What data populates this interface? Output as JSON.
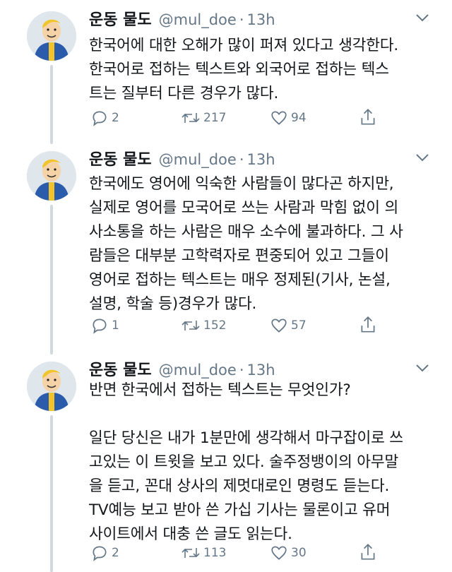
{
  "tweets": [
    {
      "name": "운동 물도",
      "handle": "@mul_doe",
      "time": "13h",
      "text": "한국어에 대한 오해가 많이 퍼져 있다고 생각한다.\n한국어로 접하는 텍스트와 외국어로 접하는 텍스\n트는 질부터 다른 경우가 많다.",
      "replies": "2",
      "retweets": "217",
      "likes": "94"
    },
    {
      "name": "운동 물도",
      "handle": "@mul_doe",
      "time": "13h",
      "text": "한국에도 영어에 익숙한 사람들이 많다곤 하지만,\n실제로 영어를 모국어로 쓰는 사람과 막힘 없이 의\n사소통을 하는 사람은 매우 소수에 불과하다. 그 사\n람들은 대부분 고학력자로 편중되어 있고 그들이\n영어로 접하는 텍스트는 매우 정제된(기사, 논설,\n설명, 학술 등)경우가 많다.",
      "replies": "1",
      "retweets": "152",
      "likes": "57"
    },
    {
      "name": "운동 물도",
      "handle": "@mul_doe",
      "time": "13h",
      "text": "반면 한국에서 접하는 텍스트는 무엇인가?\n\n일단 당신은 내가 1분만에 생각해서 마구잡이로 쓰\n고있는 이 트윗을 보고 있다. 술주정뱅이의 아무말\n을 듣고, 꼰대 상사의 제멋대로인 명령도 듣는다.\nTV예능 보고 받아 쓴 가십 기사는 물론이고 유머\n사이트에서 대충 쓴 글도 읽는다.",
      "replies": "2",
      "retweets": "113",
      "likes": "30"
    }
  ],
  "colors": {
    "text": "#14171a",
    "secondary": "#657786",
    "thread_line": "#cfd9de"
  },
  "icons": [
    "avatar",
    "chevron-down-icon",
    "reply-icon",
    "retweet-icon",
    "like-icon",
    "share-icon"
  ]
}
